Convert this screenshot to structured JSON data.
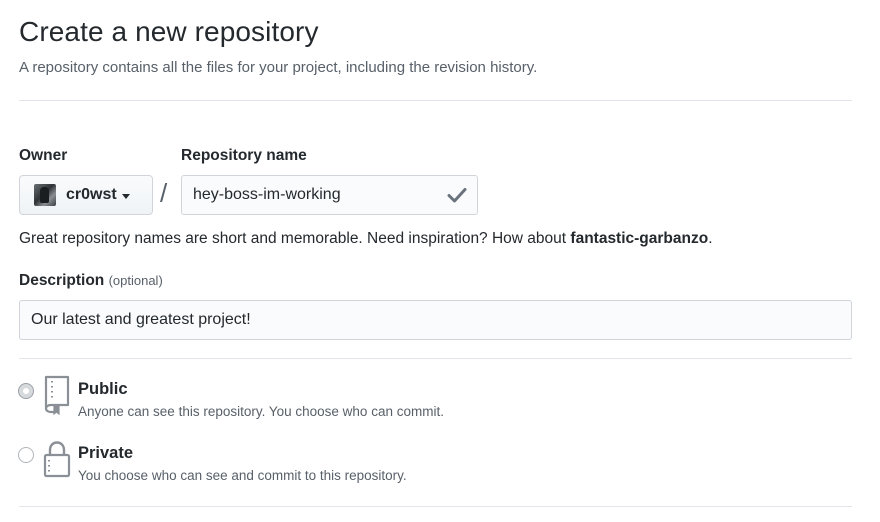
{
  "header": {
    "title": "Create a new repository",
    "subtitle": "A repository contains all the files for your project, including the revision history."
  },
  "owner": {
    "label": "Owner",
    "selected": "cr0wst",
    "avatar_icon": "user-avatar"
  },
  "separator": "/",
  "repository": {
    "label": "Repository name",
    "value": "hey-boss-im-working",
    "status_icon": "check-icon"
  },
  "hint": {
    "text": "Great repository names are short and memorable. Need inspiration? How about ",
    "suggestion": "fantastic-garbanzo",
    "end": "."
  },
  "description": {
    "label": "Description",
    "optional": "(optional)",
    "value": "Our latest and greatest project!"
  },
  "visibility": {
    "selected": "public",
    "public": {
      "title": "Public",
      "desc": "Anyone can see this repository. You choose who can commit.",
      "icon": "repo-book-icon"
    },
    "private": {
      "title": "Private",
      "desc": "You choose who can see and commit to this repository.",
      "icon": "lock-icon"
    }
  },
  "colors": {
    "text": "#24292e",
    "muted": "#586069",
    "border": "#d1d5da",
    "divider": "#e1e4e8"
  }
}
